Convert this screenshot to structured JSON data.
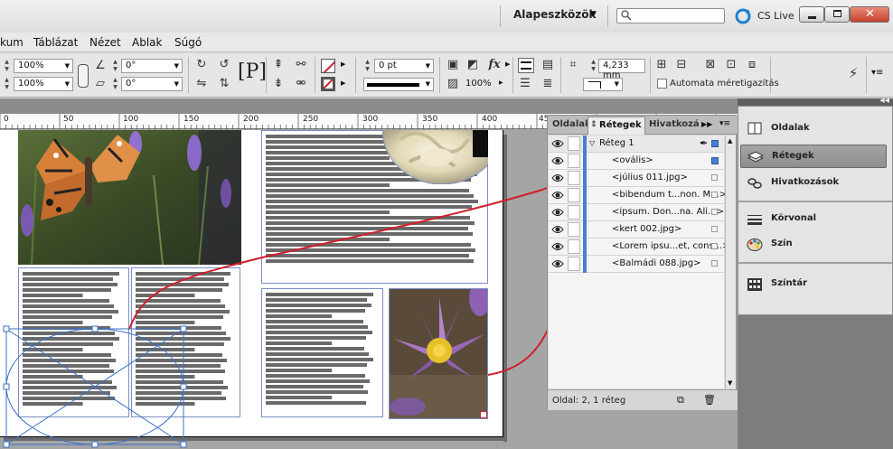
{
  "menubar": {
    "items": [
      "kum",
      "Táblázat",
      "Nézet",
      "Ablak",
      "Súgó"
    ]
  },
  "titlebar": {
    "workspace": "Alapeszközök",
    "search_placeholder": "",
    "cs_live": "CS Live"
  },
  "toolbar": {
    "scale_x": "100%",
    "scale_y": "100%",
    "rotate": "0°",
    "shear": "0°",
    "stroke_weight": "0 pt",
    "opacity": "100%",
    "dimension": "4,233 mm",
    "autofit_label": "Automata méretigazítás",
    "autofit_checked": false
  },
  "ruler": {
    "labels": [
      "0",
      "50",
      "100",
      "150",
      "200",
      "250",
      "300",
      "350",
      "400",
      "45"
    ]
  },
  "layers_panel": {
    "tabs": [
      "Oldalak",
      "Rétegek",
      "Hivatkozá"
    ],
    "active_tab": "Rétegek",
    "layer_name": "Réteg 1",
    "items": [
      "<ovális>",
      "<július 011.jpg>",
      "<bibendum t...non. M...>",
      "<ipsum. Don...na. Ali...>",
      "<kert 002.jpg>",
      "<Lorem ipsu...et, cons...>",
      "<Balmádi 088.jpg>"
    ],
    "status": "Oldal: 2, 1 réteg",
    "layer_color": "#4a7fcf"
  },
  "dock": {
    "items": [
      {
        "label": "Oldalak",
        "icon": "pages-icon"
      },
      {
        "label": "Rétegek",
        "icon": "layers-icon"
      },
      {
        "label": "Hivatkozások",
        "icon": "links-icon"
      },
      {
        "label": "Körvonal",
        "icon": "stroke-icon"
      },
      {
        "label": "Szín",
        "icon": "color-icon"
      },
      {
        "label": "Színtár",
        "icon": "swatches-icon"
      }
    ],
    "selected": "Rétegek"
  },
  "colors": {
    "accent": "#4a7fcf",
    "annotation": "#d01f2a"
  }
}
